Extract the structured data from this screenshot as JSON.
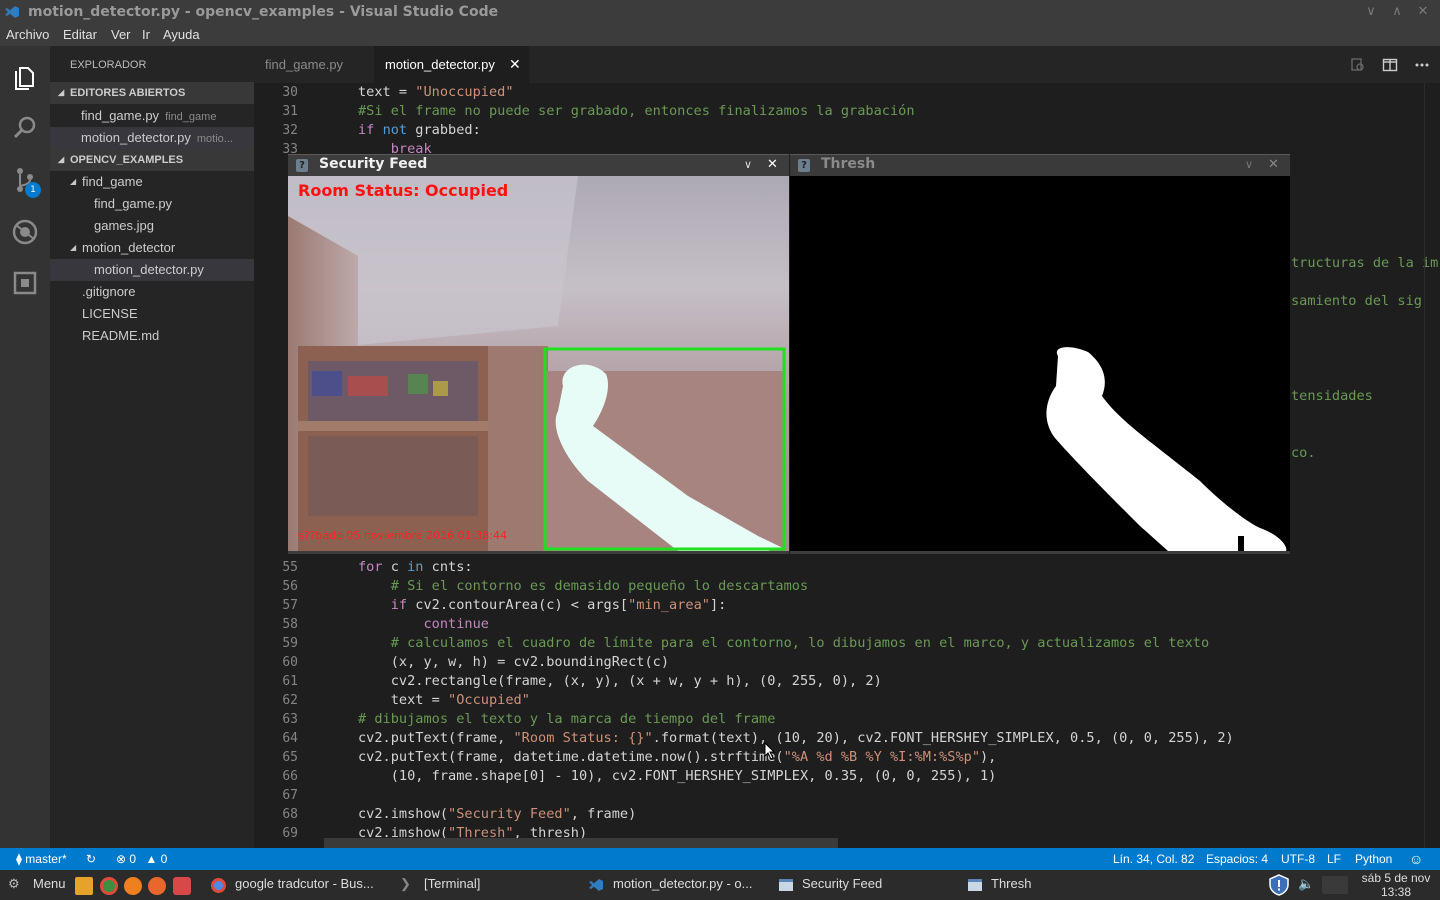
{
  "window": {
    "title": "motion_detector.py - opencv_examples - Visual Studio Code",
    "controls": [
      "∨",
      "∧",
      "✕"
    ]
  },
  "menu": [
    "Archivo",
    "Editar",
    "Ver",
    "Ir",
    "Ayuda"
  ],
  "activity": {
    "items": [
      "explorer-icon",
      "search-icon",
      "source-control-icon",
      "debug-icon",
      "extensions-icon"
    ],
    "scm_badge": "1"
  },
  "sidebar": {
    "header": "EXPLORADOR",
    "open_editors": {
      "title": "EDITORES ABIERTOS",
      "items": [
        {
          "name": "find_game.py",
          "desc": "find_game"
        },
        {
          "name": "motion_detector.py",
          "desc": "motio..."
        }
      ]
    },
    "workspace": {
      "title": "OPENCV_EXAMPLES",
      "items": [
        {
          "name": "find_game"
        },
        {
          "name": "find_game.py"
        },
        {
          "name": "games.jpg"
        },
        {
          "name": "motion_detector"
        },
        {
          "name": "motion_detector.py"
        },
        {
          "name": ".gitignore"
        },
        {
          "name": "LICENSE"
        },
        {
          "name": "README.md"
        }
      ]
    }
  },
  "tabs": [
    {
      "label": "find_game.py"
    },
    {
      "label": "motion_detector.py",
      "close": "✕"
    }
  ],
  "editor": {
    "top_lines": [
      {
        "n": "30"
      },
      {
        "n": "31"
      },
      {
        "n": "32"
      },
      {
        "n": "33"
      }
    ],
    "bottom_lines": [
      {
        "n": "55"
      },
      {
        "n": "56"
      },
      {
        "n": "57"
      },
      {
        "n": "58"
      },
      {
        "n": "59"
      },
      {
        "n": "60"
      },
      {
        "n": "61"
      },
      {
        "n": "62"
      },
      {
        "n": "63"
      },
      {
        "n": "64"
      },
      {
        "n": "65"
      },
      {
        "n": "66"
      },
      {
        "n": "67"
      },
      {
        "n": "68"
      },
      {
        "n": "69"
      }
    ],
    "partial_right": [
      "tructuras de la im",
      "samiento del sig",
      "tensidades",
      "co."
    ]
  },
  "cv_windows": {
    "security": {
      "title": "Security Feed",
      "status_text": "Room Status: Occupied",
      "timestamp": "s??bado 05 noviembre 2016 01:38:44"
    },
    "thresh": {
      "title": "Thresh"
    },
    "chevron": "∨",
    "close": "✕",
    "help": "?"
  },
  "statusbar": {
    "branch": "master*",
    "errors": "0",
    "warnings": "0",
    "position": "Lín. 34, Col. 82",
    "spaces": "Espacios: 4",
    "encoding": "UTF-8",
    "eol": "LF",
    "language": "Python"
  },
  "taskbar": {
    "menu": "Menu",
    "windows": [
      "google tradcutor - Bus...",
      "[Terminal]",
      "motion_detector.py - o...",
      "Security Feed",
      "Thresh"
    ],
    "clock_day": "sáb  5 de nov",
    "clock_time": "13:38"
  },
  "colors": {
    "accent": "#007acc",
    "status_text_red": "#ff0000",
    "detect_box": "#00ff00"
  }
}
